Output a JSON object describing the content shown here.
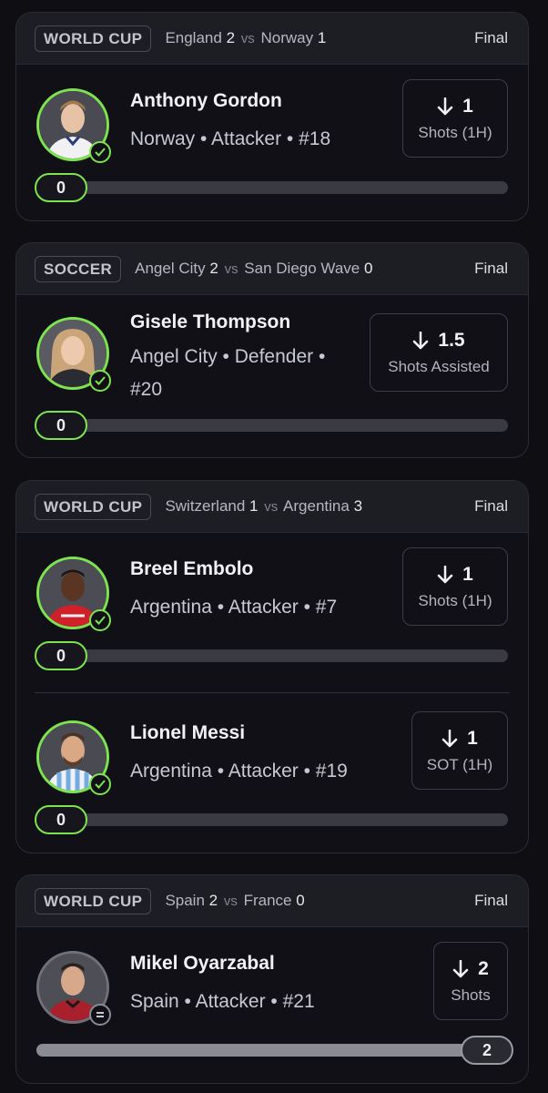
{
  "cards": [
    {
      "league": "WORLD CUP",
      "home_team": "England",
      "home_score": "2",
      "vs": "vs",
      "away_team": "Norway",
      "away_score": "1",
      "status": "Final",
      "players": [
        {
          "name": "Anthony Gordon",
          "meta_line1": "Norway • Attacker • #18",
          "meta_line2": "",
          "stat_value": "1",
          "stat_label": "Shots (1H)",
          "stat_direction": "down",
          "progress_value": "0",
          "progress_fraction": 0,
          "result": "hit"
        }
      ]
    },
    {
      "league": "SOCCER",
      "home_team": "Angel City",
      "home_score": "2",
      "vs": "vs",
      "away_team": "San Diego Wave",
      "away_score": "0",
      "status": "Final",
      "players": [
        {
          "name": "Gisele Thompson",
          "meta_line1": "Angel City • Defender •",
          "meta_line2": "#20",
          "stat_value": "1.5",
          "stat_label": "Shots Assisted",
          "stat_direction": "down",
          "progress_value": "0",
          "progress_fraction": 0,
          "result": "hit"
        }
      ]
    },
    {
      "league": "WORLD CUP",
      "home_team": "Switzerland",
      "home_score": "1",
      "vs": "vs",
      "away_team": "Argentina",
      "away_score": "3",
      "status": "Final",
      "players": [
        {
          "name": "Breel Embolo",
          "meta_line1": "Argentina • Attacker • #7",
          "meta_line2": "",
          "stat_value": "1",
          "stat_label": "Shots (1H)",
          "stat_direction": "down",
          "progress_value": "0",
          "progress_fraction": 0,
          "result": "hit"
        },
        {
          "name": "Lionel Messi",
          "meta_line1": "Argentina • Attacker • #19",
          "meta_line2": "",
          "stat_value": "1",
          "stat_label": "SOT (1H)",
          "stat_direction": "down",
          "progress_value": "0",
          "progress_fraction": 0,
          "result": "hit"
        }
      ]
    },
    {
      "league": "WORLD CUP",
      "home_team": "Spain",
      "home_score": "2",
      "vs": "vs",
      "away_team": "France",
      "away_score": "0",
      "status": "Final",
      "players": [
        {
          "name": "Mikel Oyarzabal",
          "meta_line1": "Spain • Attacker • #21",
          "meta_line2": "",
          "stat_value": "2",
          "stat_label": "Shots",
          "stat_direction": "down",
          "progress_value": "2",
          "progress_fraction": 1,
          "result": "push"
        }
      ]
    }
  ],
  "colors": {
    "hit_accent": "#7de34f",
    "push_accent": "#9a9aa2",
    "card_bg": "#101016",
    "header_bg": "#1d1d24"
  },
  "icons": {
    "hit": "checkmark-icon",
    "push": "equals-icon",
    "direction": "arrow-down-icon"
  }
}
